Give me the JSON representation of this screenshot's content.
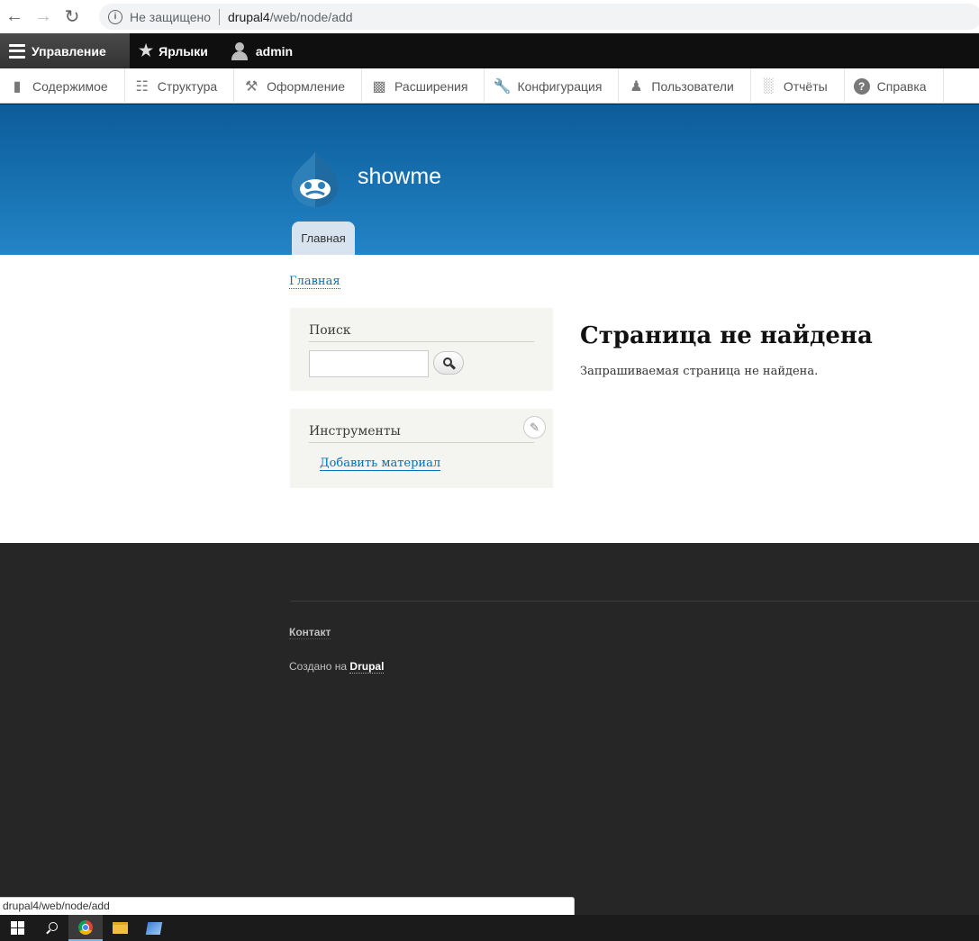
{
  "browser": {
    "security_text": "Не защищено",
    "url_host": "drupal4",
    "url_path": "/web/node/add"
  },
  "toolbar": {
    "manage": "Управление",
    "shortcuts": "Ярлыки",
    "user": "admin",
    "tray": [
      {
        "label": "Содержимое",
        "icon": "page-icon"
      },
      {
        "label": "Структура",
        "icon": "sitemap-icon"
      },
      {
        "label": "Оформление",
        "icon": "brush-icon"
      },
      {
        "label": "Расширения",
        "icon": "puzzle-icon"
      },
      {
        "label": "Конфигурация",
        "icon": "wrench-icon"
      },
      {
        "label": "Пользователи",
        "icon": "people-icon"
      },
      {
        "label": "Отчёты",
        "icon": "bar-chart-icon"
      },
      {
        "label": "Справка",
        "icon": "help-icon"
      }
    ]
  },
  "header": {
    "site_name": "showme",
    "tab_home": "Главная"
  },
  "main": {
    "breadcrumb": "Главная",
    "search_block_title": "Поиск",
    "tools_block_title": "Инструменты",
    "add_content_link": "Добавить материал",
    "page_title": "Страница не найдена",
    "page_text": "Запрашиваемая страница не найдена."
  },
  "footer": {
    "contact": "Контакт",
    "made_with": "Создано на",
    "drupal": "Drupal"
  },
  "status_bubble": "drupal4/web/node/add",
  "colors": {
    "header_top": "#0c5c99",
    "header_bottom": "#2384c6",
    "link": "#0071b8",
    "footer_bg": "#262626"
  }
}
